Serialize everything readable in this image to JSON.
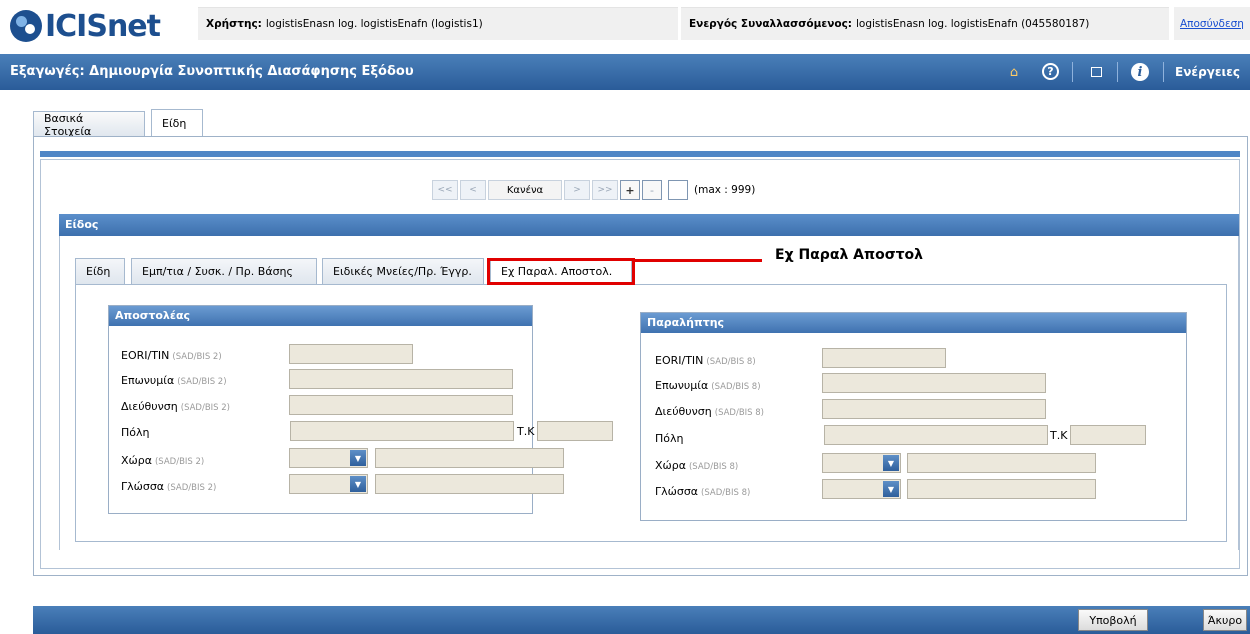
{
  "header": {
    "logo": "ICISnet",
    "user_label": "Χρήστης:",
    "user_value": "logistisEnasn log. logistisEnafn (logistis1)",
    "trader_label": "Ενεργός Συναλλασσόμενος:",
    "trader_value": "logistisEnasn log. logistisEnafn (045580187)",
    "logout": "Αποσύνδεση"
  },
  "titlebar": {
    "title": "Εξαγωγές: Δημιουργία Συνοπτικής Διασάφησης Εξόδου",
    "actions": "Ενέργειες",
    "icons": [
      "home-icon",
      "help-icon",
      "window-icon",
      "info-icon"
    ]
  },
  "outer_tabs": [
    {
      "label": "Βασικά Στοιχεία"
    },
    {
      "label": "Είδη"
    }
  ],
  "pager": {
    "first": "<<",
    "prev": "<",
    "current": "Κανένα",
    "next": ">",
    "last": ">>",
    "add": "+",
    "remove": "-",
    "max": "(max : 999)"
  },
  "item": {
    "title": "Είδος",
    "tabs": [
      {
        "label": "Είδη"
      },
      {
        "label": "Εμπ/τια / Συσκ. / Πρ. Βάσης"
      },
      {
        "label": "Ειδικές Μνείες/Πρ. Έγγρ."
      },
      {
        "label": "Εχ Παραλ. Αποστολ."
      }
    ],
    "callout": "Εχ Παραλ Αποστολ"
  },
  "consignor": {
    "title": "Αποστολέας",
    "fields": {
      "eori": {
        "label": "EORI/TIN",
        "ref": "(SAD/BIS 2)"
      },
      "name": {
        "label": "Επωνυμία",
        "ref": "(SAD/BIS 2)"
      },
      "address": {
        "label": "Διεύθυνση",
        "ref": "(SAD/BIS 2)"
      },
      "city": {
        "label": "Πόλη"
      },
      "postcode": {
        "label": "Τ.Κ"
      },
      "country": {
        "label": "Χώρα",
        "ref": "(SAD/BIS 2)"
      },
      "language": {
        "label": "Γλώσσα",
        "ref": "(SAD/BIS 2)"
      }
    }
  },
  "consignee": {
    "title": "Παραλήπτης",
    "fields": {
      "eori": {
        "label": "EORI/TIN",
        "ref": "(SAD/BIS 8)"
      },
      "name": {
        "label": "Επωνυμία",
        "ref": "(SAD/BIS 8)"
      },
      "address": {
        "label": "Διεύθυνση",
        "ref": "(SAD/BIS 8)"
      },
      "city": {
        "label": "Πόλη"
      },
      "postcode": {
        "label": "Τ.Κ"
      },
      "country": {
        "label": "Χώρα",
        "ref": "(SAD/BIS 8)"
      },
      "language": {
        "label": "Γλώσσα",
        "ref": "(SAD/BIS 8)"
      }
    }
  },
  "footer": {
    "submit": "Υποβολή",
    "cancel": "Άκυρο"
  }
}
